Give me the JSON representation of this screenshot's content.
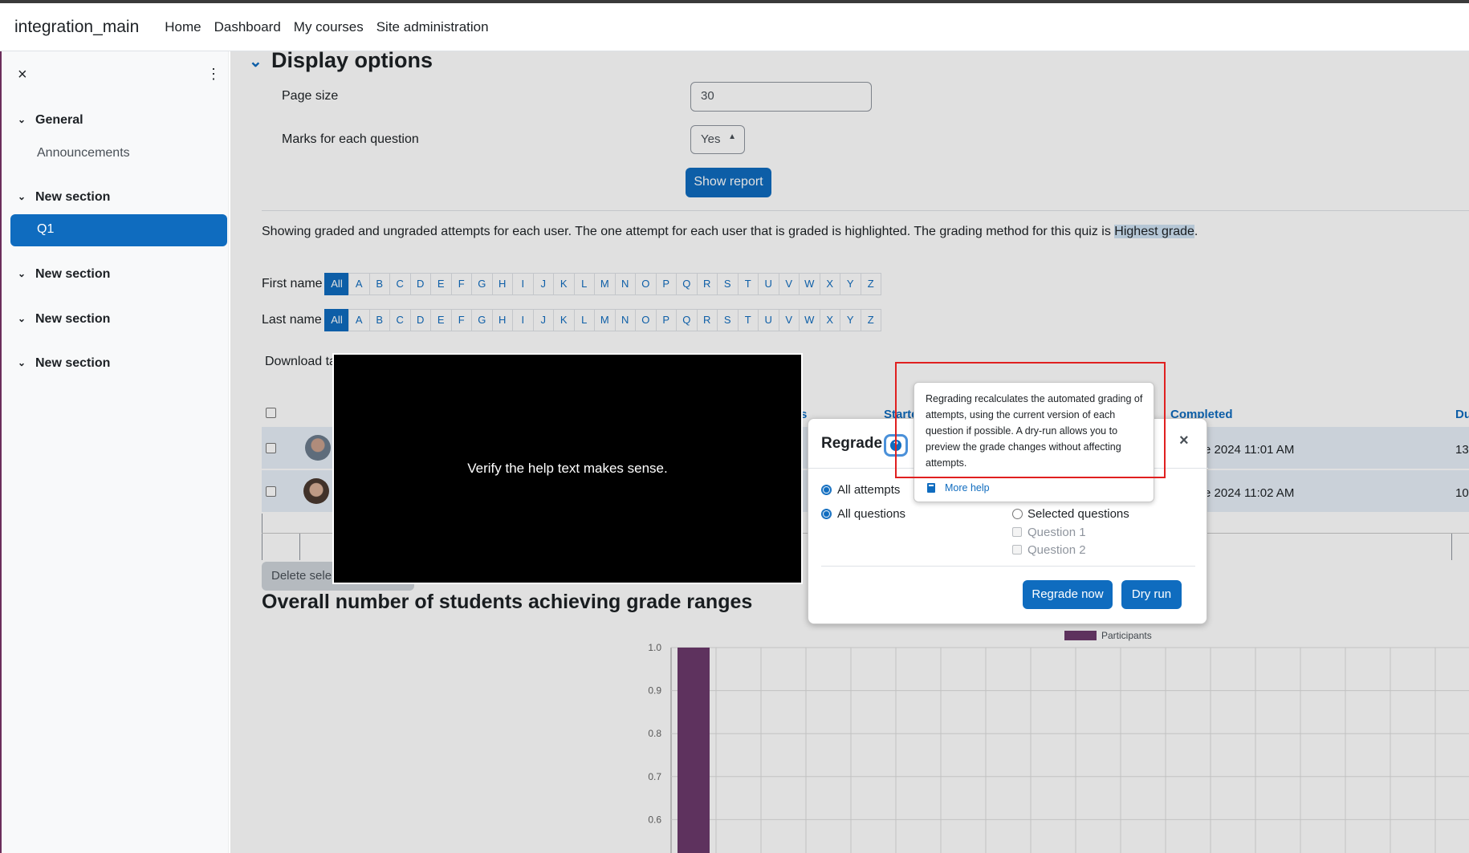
{
  "topbar": {
    "site_name": "integration_main",
    "nav": [
      "Home",
      "Dashboard",
      "My courses",
      "Site administration"
    ]
  },
  "drawer": {
    "close_icon": "×",
    "more_icon": "⋮",
    "sections": [
      {
        "title": "General",
        "items": [
          "Announcements"
        ]
      },
      {
        "title": "New section",
        "items": [
          "Q1"
        ]
      },
      {
        "title": "New section",
        "items": []
      },
      {
        "title": "New section",
        "items": []
      },
      {
        "title": "New section",
        "items": []
      }
    ],
    "active_item": "Q1"
  },
  "display_options": {
    "heading": "Display options",
    "page_size_label": "Page size",
    "page_size_value": "30",
    "marks_label": "Marks for each question",
    "marks_value": "Yes",
    "show_report": "Show report"
  },
  "info_text_before": "Showing graded and ungraded attempts for each user. The one attempt for each user that is graded is highlighted. The grading method for this quiz is ",
  "info_text_highlight": "Highest grade",
  "info_text_after": ".",
  "initials": {
    "first_label": "First name",
    "last_label": "Last name",
    "letters": [
      "All",
      "A",
      "B",
      "C",
      "D",
      "E",
      "F",
      "G",
      "H",
      "I",
      "J",
      "K",
      "L",
      "M",
      "N",
      "O",
      "P",
      "Q",
      "R",
      "S",
      "T",
      "U",
      "V",
      "W",
      "X",
      "Y",
      "Z"
    ]
  },
  "download_label": "Download ta",
  "table": {
    "col_started": "Starte",
    "col_completed": "Completed",
    "col_duration": "Du",
    "col_s": "s",
    "rows": [
      {
        "completed": "e 2024 11:01 AM",
        "duration": "13"
      },
      {
        "completed": "e 2024 11:02 AM",
        "duration": "10"
      }
    ]
  },
  "delete_button": "Delete sele",
  "overall_heading": "Overall number of students achieving grade ranges",
  "chart_data": {
    "type": "bar",
    "legend": [
      "Participants"
    ],
    "series": [
      {
        "name": "Participants",
        "values": [
          1.0
        ]
      }
    ],
    "y_ticks": [
      "1.0",
      "0.9",
      "0.8",
      "0.7",
      "0.6"
    ],
    "ylim": [
      0.55,
      1.0
    ],
    "bar_color": "#6b3a6b",
    "grid": true
  },
  "video_text": "Verify the help text makes sense.",
  "modal": {
    "title": "Regrade",
    "help_icon": "?",
    "close_icon": "×",
    "opt_all_attempts": "All attempts",
    "opt_all_questions": "All questions",
    "opt_selected_questions": "Selected questions",
    "question_1": "Question 1",
    "question_2": "Question 2",
    "regrade_now": "Regrade now",
    "dry_run": "Dry run"
  },
  "popover": {
    "text": "Regrading recalculates the automated grading of attempts, using the current version of each question if possible. A dry-run allows you to preview the grade changes without affecting attempts.",
    "more_help": "More help"
  }
}
